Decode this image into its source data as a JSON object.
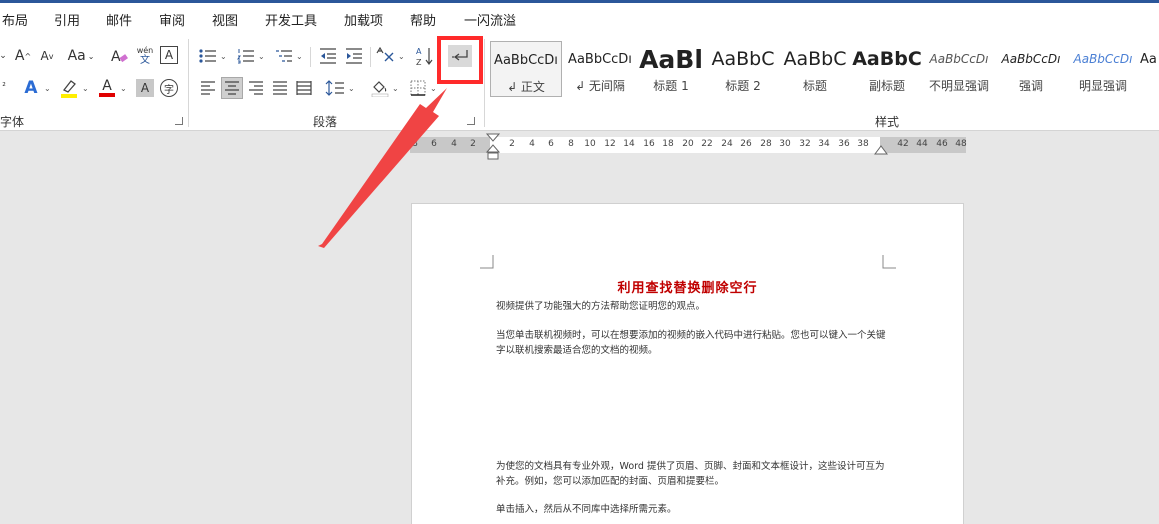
{
  "tabs": [
    "布局",
    "引用",
    "邮件",
    "审阅",
    "视图",
    "开发工具",
    "加载项",
    "帮助",
    "一闪流溢"
  ],
  "groups": {
    "font": "字体",
    "paragraph": "段落",
    "styles": "样式"
  },
  "font_buttons": {
    "grow": "A",
    "shrink": "A",
    "case": "Aa",
    "clear": "A",
    "phonetic_top": "wén",
    "phonetic_bottom": "文",
    "border_char": "A",
    "shade_char": "A",
    "enclose": "字",
    "effect": "A",
    "color": "A",
    "superscript": "²"
  },
  "styles": [
    {
      "preview": "AaBbCcDı",
      "name": "↲ 正文"
    },
    {
      "preview": "AaBbCcDı",
      "name": "↲ 无间隔"
    },
    {
      "preview": "AaBl",
      "name": "标题 1"
    },
    {
      "preview": "AaBbC",
      "name": "标题 2"
    },
    {
      "preview": "AaBbC",
      "name": "标题"
    },
    {
      "preview": "AaBbC",
      "name": "副标题"
    },
    {
      "preview": "AaBbCcDı",
      "name": "不明显强调"
    },
    {
      "preview": "AaBbCcDı",
      "name": "强调"
    },
    {
      "preview": "AaBbCcDı",
      "name": "明显强调"
    },
    {
      "preview": "Aa",
      "name": ""
    }
  ],
  "ruler": {
    "left": [
      "8",
      "6",
      "4",
      "2"
    ],
    "right": [
      "2",
      "4",
      "6",
      "8",
      "10",
      "12",
      "14",
      "16",
      "18",
      "20",
      "22",
      "24",
      "26",
      "28",
      "30",
      "32",
      "34",
      "36",
      "38",
      "42",
      "44",
      "46",
      "48"
    ]
  },
  "document": {
    "title": "利用查找替换删除空行",
    "p1": "视频提供了功能强大的方法帮助您证明您的观点。",
    "p2": "当您单击联机视频时，可以在想要添加的视频的嵌入代码中进行粘贴。您也可以键入一个关键字以联机搜索最适合您的文档的视频。",
    "p3": "为使您的文档具有专业外观，Word 提供了页眉、页脚、封面和文本框设计，这些设计可互为补充。例如，您可以添加匹配的封面、页眉和提要栏。",
    "p4": "单击插入，然后从不同库中选择所需元素。"
  },
  "colors": {
    "accent": "#2b579a",
    "highlight_box": "#ff2a2a",
    "arrow": "#f04444",
    "title_red": "#c00000",
    "font_color": "#e00000",
    "highlighter": "#ffee00"
  }
}
